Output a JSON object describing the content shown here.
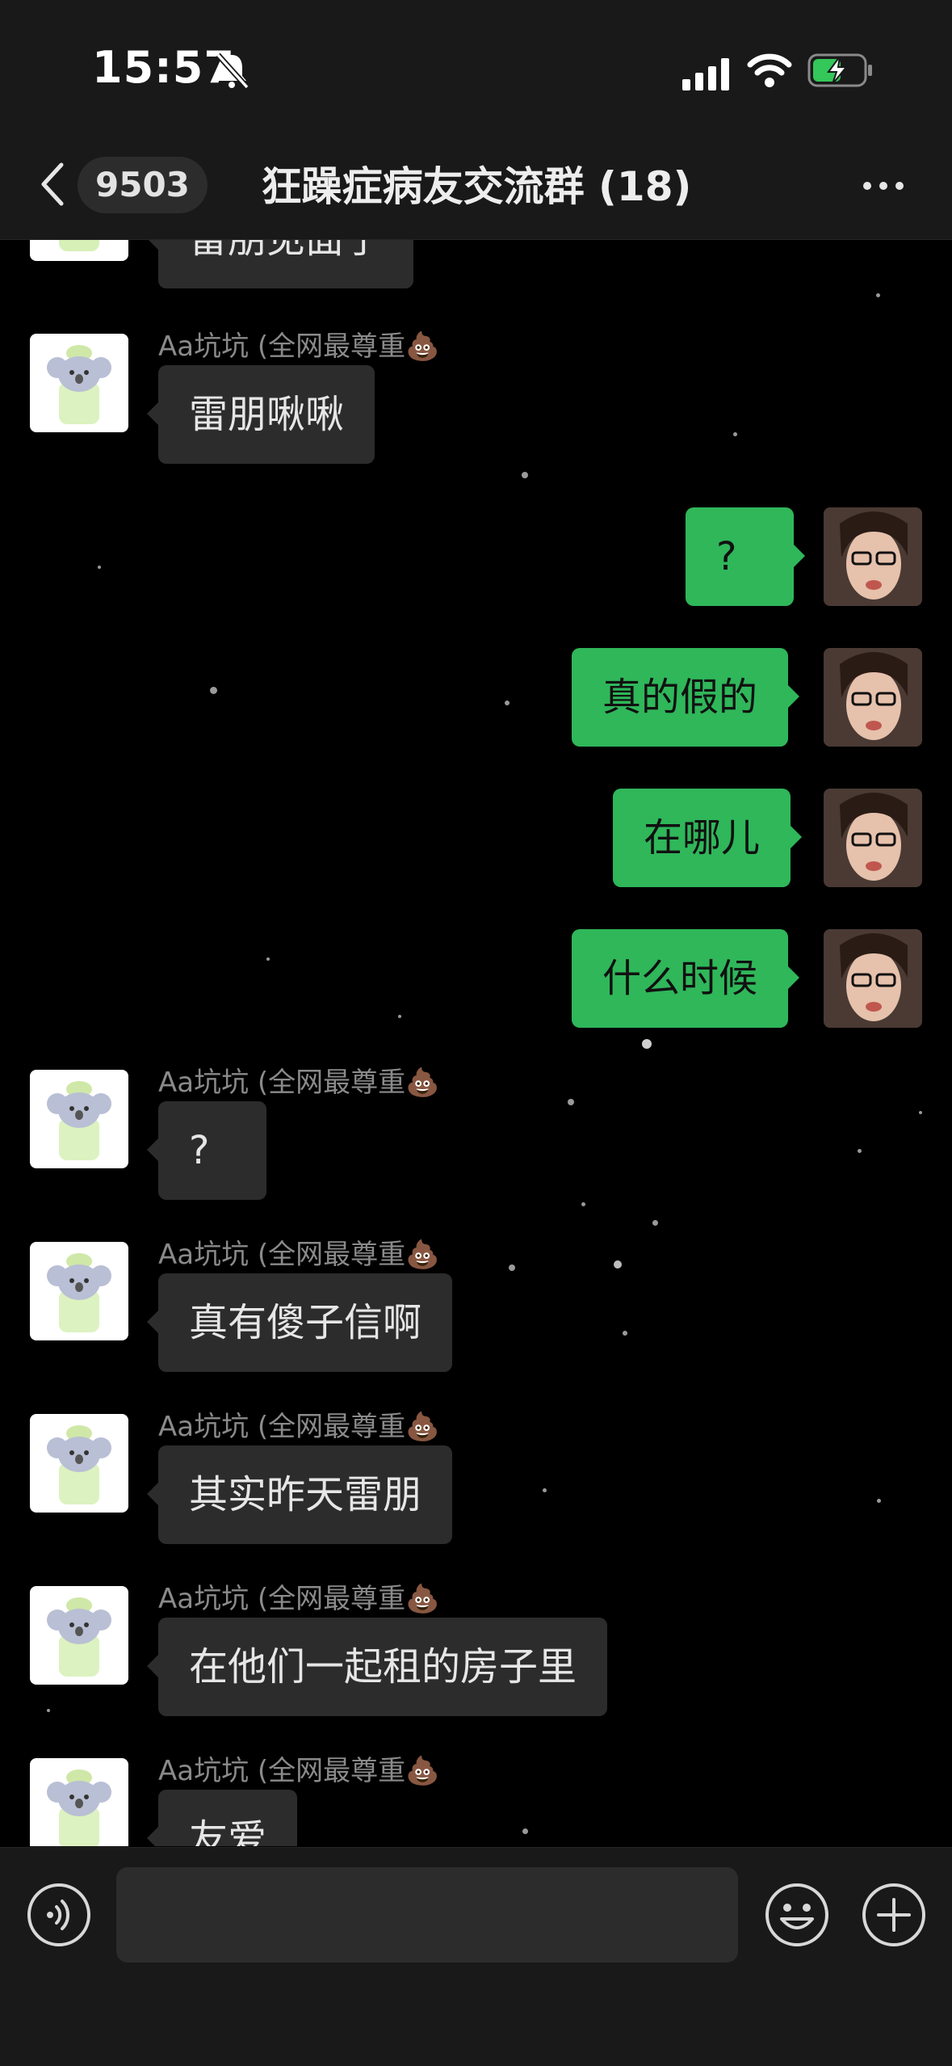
{
  "status_bar": {
    "time": "15:57"
  },
  "header": {
    "back_count": "9503",
    "title": "狂躁症病友交流群 (18)"
  },
  "messages": [
    {
      "side": "in",
      "sender": "",
      "text": "雷朋见面了"
    },
    {
      "side": "in",
      "sender": "Aa坑坑 (全网最尊重💩",
      "text": "雷朋啾啾"
    },
    {
      "side": "out",
      "text": "?"
    },
    {
      "side": "out",
      "text": "真的假的"
    },
    {
      "side": "out",
      "text": "在哪儿"
    },
    {
      "side": "out",
      "text": "什么时候"
    },
    {
      "side": "in",
      "sender": "Aa坑坑 (全网最尊重💩",
      "text": "?"
    },
    {
      "side": "in",
      "sender": "Aa坑坑 (全网最尊重💩",
      "text": "真有傻子信啊"
    },
    {
      "side": "in",
      "sender": "Aa坑坑 (全网最尊重💩",
      "text": "其实昨天雷朋"
    },
    {
      "side": "in",
      "sender": "Aa坑坑 (全网最尊重💩",
      "text": "在他们一起租的房子里"
    },
    {
      "side": "in",
      "sender": "Aa坑坑 (全网最尊重💩",
      "text": "友爱"
    }
  ],
  "input": {
    "placeholder": ""
  },
  "colors": {
    "outgoing_bubble": "#2fb75a",
    "incoming_bubble": "#2c2c2c",
    "bar_background": "#191919"
  }
}
